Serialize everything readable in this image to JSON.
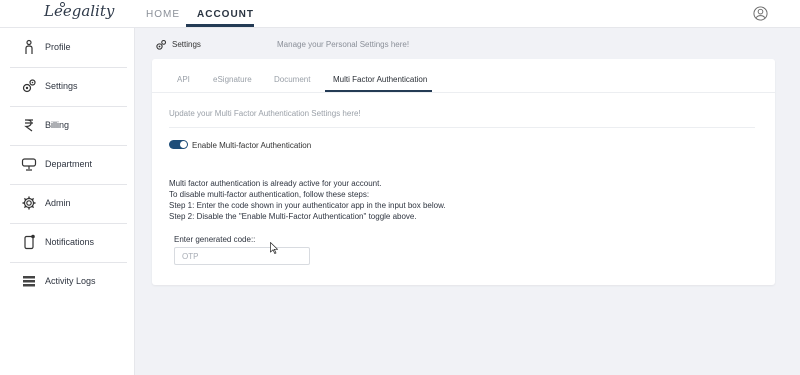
{
  "app": {
    "logo_text": "Leegality"
  },
  "topnav": {
    "tabs": [
      {
        "label": "HOME"
      },
      {
        "label": "ACCOUNT"
      }
    ],
    "active": "ACCOUNT"
  },
  "sidebar": {
    "items": [
      {
        "label": "Profile",
        "icon": "person-icon"
      },
      {
        "label": "Settings",
        "icon": "gears-icon"
      },
      {
        "label": "Billing",
        "icon": "rupee-icon"
      },
      {
        "label": "Department",
        "icon": "department-icon"
      },
      {
        "label": "Admin",
        "icon": "cog-icon"
      },
      {
        "label": "Notifications",
        "icon": "phone-notification-icon"
      },
      {
        "label": "Activity Logs",
        "icon": "logs-icon"
      }
    ]
  },
  "page": {
    "title": "Settings",
    "subtitle": "Manage your Personal Settings here!"
  },
  "settings_tabs": {
    "tabs": [
      {
        "label": "API"
      },
      {
        "label": "eSignature"
      },
      {
        "label": "Document"
      },
      {
        "label": "Multi Factor Authentication"
      }
    ],
    "active": "Multi Factor Authentication"
  },
  "mfa": {
    "heading": "Update your Multi Factor Authentication Settings here!",
    "toggle_label": "Enable Multi-factor Authentication",
    "toggle_on": true,
    "info_lines": [
      "Multi factor authentication is already active for your account.",
      "To disable multi-factor authentication, follow these steps:",
      "Step 1: Enter the code shown in your authenticator app in the input box below.",
      "Step 2: Disable the \"Enable Multi-Factor Authentication\" toggle above."
    ],
    "code_label": "Enter generated code::",
    "code_value": "",
    "code_placeholder": "OTP"
  },
  "colors": {
    "accent": "#243b55",
    "toggle": "#1f4e79",
    "background": "#f1f2f6"
  }
}
